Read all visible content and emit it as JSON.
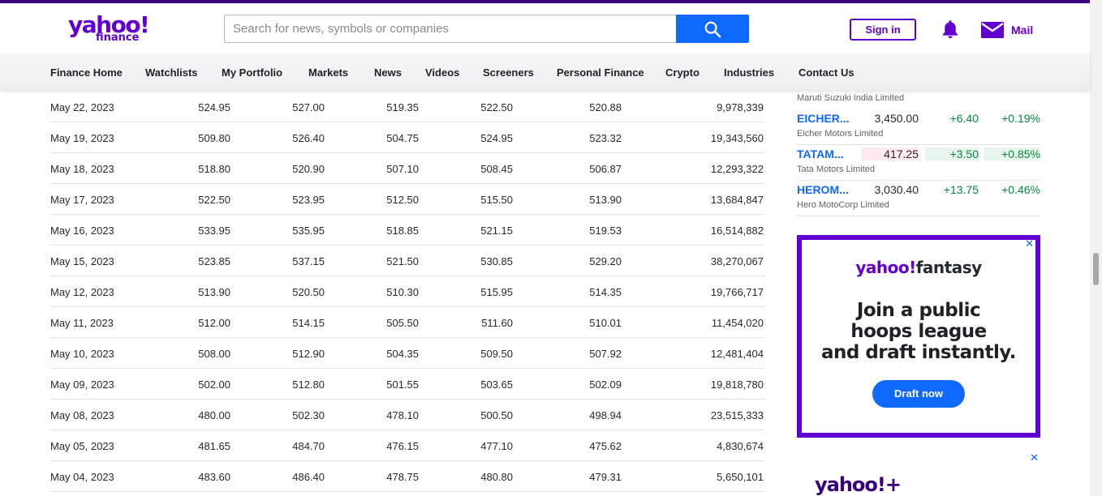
{
  "header": {
    "logo_text": "yahoo!",
    "logo_sub": "finance",
    "search_placeholder": "Search for news, symbols or companies",
    "search_icon": "search-icon",
    "signin_label": "Sign in",
    "bell_icon": "bell-icon",
    "mail_icon": "mail-icon",
    "mail_label": "Mail"
  },
  "nav": [
    {
      "label": "Finance Home"
    },
    {
      "label": "Watchlists"
    },
    {
      "label": "My Portfolio"
    },
    {
      "label": "Markets"
    },
    {
      "label": "News"
    },
    {
      "label": "Videos"
    },
    {
      "label": "Screeners"
    },
    {
      "label": "Personal Finance"
    },
    {
      "label": "Crypto"
    },
    {
      "label": "Industries"
    },
    {
      "label": "Contact Us"
    }
  ],
  "history": {
    "rows": [
      {
        "date": "May 22, 2023",
        "open": "524.95",
        "high": "527.00",
        "low": "519.35",
        "close": "522.50",
        "adj_close": "520.88",
        "volume": "9,978,339"
      },
      {
        "date": "May 19, 2023",
        "open": "509.80",
        "high": "526.40",
        "low": "504.75",
        "close": "524.95",
        "adj_close": "523.32",
        "volume": "19,343,560"
      },
      {
        "date": "May 18, 2023",
        "open": "518.80",
        "high": "520.90",
        "low": "507.10",
        "close": "508.45",
        "adj_close": "506.87",
        "volume": "12,293,322"
      },
      {
        "date": "May 17, 2023",
        "open": "522.50",
        "high": "523.95",
        "low": "512.50",
        "close": "515.50",
        "adj_close": "513.90",
        "volume": "13,684,847"
      },
      {
        "date": "May 16, 2023",
        "open": "533.95",
        "high": "535.95",
        "low": "518.85",
        "close": "521.15",
        "adj_close": "519.53",
        "volume": "16,514,882"
      },
      {
        "date": "May 15, 2023",
        "open": "523.85",
        "high": "537.15",
        "low": "521.50",
        "close": "530.85",
        "adj_close": "529.20",
        "volume": "38,270,067"
      },
      {
        "date": "May 12, 2023",
        "open": "513.90",
        "high": "520.50",
        "low": "510.30",
        "close": "515.95",
        "adj_close": "514.35",
        "volume": "19,766,717"
      },
      {
        "date": "May 11, 2023",
        "open": "512.00",
        "high": "514.15",
        "low": "505.50",
        "close": "511.60",
        "adj_close": "510.01",
        "volume": "11,454,020"
      },
      {
        "date": "May 10, 2023",
        "open": "508.00",
        "high": "512.90",
        "low": "504.35",
        "close": "509.50",
        "adj_close": "507.92",
        "volume": "12,481,404"
      },
      {
        "date": "May 09, 2023",
        "open": "502.00",
        "high": "512.80",
        "low": "501.55",
        "close": "503.65",
        "adj_close": "502.09",
        "volume": "19,818,780"
      },
      {
        "date": "May 08, 2023",
        "open": "480.00",
        "high": "502.30",
        "low": "478.10",
        "close": "500.50",
        "adj_close": "498.94",
        "volume": "23,515,333"
      },
      {
        "date": "May 05, 2023",
        "open": "481.65",
        "high": "484.70",
        "low": "476.15",
        "close": "477.10",
        "adj_close": "475.62",
        "volume": "4,830,674"
      },
      {
        "date": "May 04, 2023",
        "open": "483.60",
        "high": "486.40",
        "low": "478.75",
        "close": "480.80",
        "adj_close": "479.31",
        "volume": "5,650,101"
      }
    ]
  },
  "sidebar": {
    "partial_name": "Maruti Suzuki India Limited",
    "quotes": [
      {
        "symbol": "EICHER...",
        "price": "3,450.00",
        "change": "+6.40",
        "pct": "+0.19%",
        "name": "Eicher Motors Limited"
      },
      {
        "symbol": "TATAM...",
        "price": "417.25",
        "change": "+3.50",
        "pct": "+0.85%",
        "name": "Tata Motors Limited"
      },
      {
        "symbol": "HEROM...",
        "price": "3,030.40",
        "change": "+13.75",
        "pct": "+0.46%",
        "name": "Hero MotoCorp Limited"
      }
    ]
  },
  "ads": {
    "ad1_brand": "yahoo!",
    "ad1_brand_suffix": "fantasy",
    "ad1_line1": "Join a public",
    "ad1_line2": "hoops league",
    "ad1_line3": "and draft instantly.",
    "ad1_cta": "Draft now",
    "ad_close": "✕",
    "ad2_brand": "yahoo!+"
  },
  "colors": {
    "brand": "#6001d2",
    "accent": "#0f69ff",
    "positive": "#008a3e"
  }
}
